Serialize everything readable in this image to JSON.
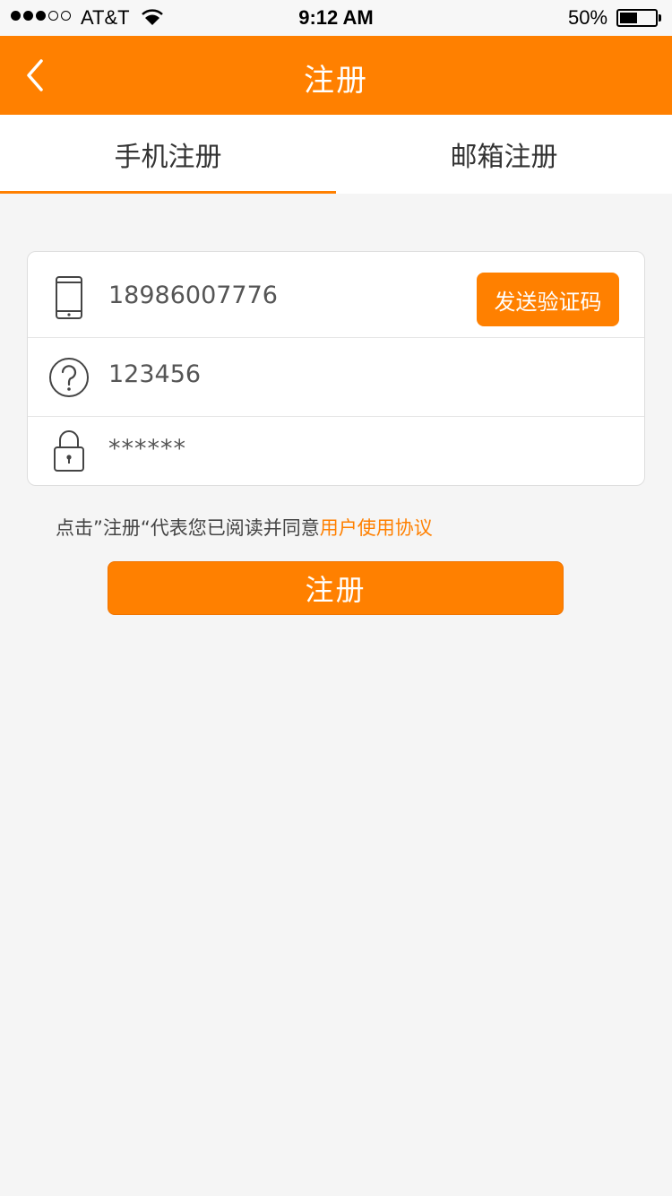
{
  "status_bar": {
    "carrier": "AT&T",
    "time": "9:12 AM",
    "battery_percent": "50%",
    "battery_level": 0.5
  },
  "nav": {
    "title": "注册",
    "back_icon": "chevron-left-icon"
  },
  "tabs": [
    {
      "label": "手机注册",
      "active": true
    },
    {
      "label": "邮箱注册",
      "active": false
    }
  ],
  "form": {
    "phone": {
      "icon": "phone-icon",
      "value": "18986007776"
    },
    "send_code_label": "发送验证码",
    "code": {
      "icon": "question-circle-icon",
      "value": "123456"
    },
    "password": {
      "icon": "lock-icon",
      "value": "******"
    }
  },
  "agreement": {
    "text": "点击”注册“代表您已阅读并同意",
    "link": "用户使用协议"
  },
  "register_label": "注册",
  "colors": {
    "accent": "#ff8000",
    "background": "#f5f5f5"
  }
}
